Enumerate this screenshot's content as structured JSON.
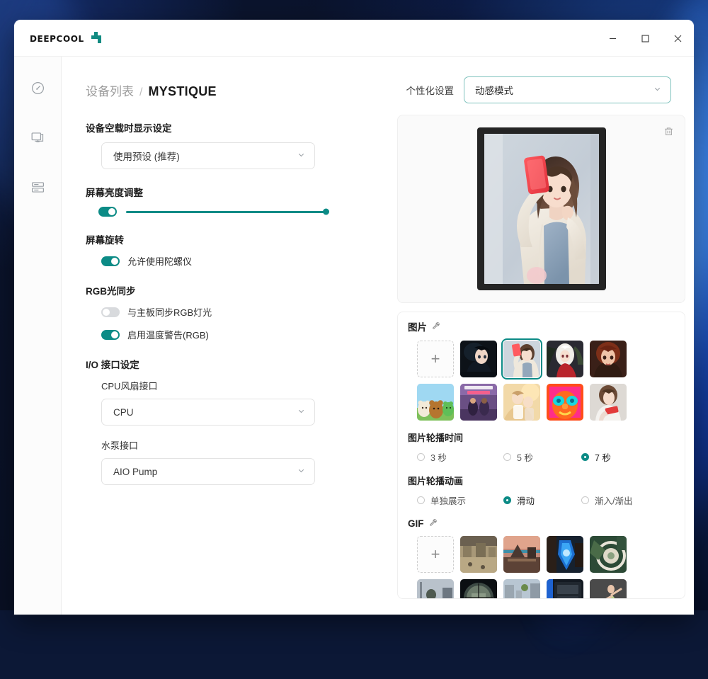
{
  "window": {
    "brand": "DeepCool",
    "controls": {
      "minimize": "–",
      "maximize": "□",
      "close": "✕"
    }
  },
  "sidebar": {
    "items": [
      {
        "name": "dashboard",
        "icon": "gauge-icon"
      },
      {
        "name": "display",
        "icon": "monitor-icon"
      },
      {
        "name": "devices",
        "icon": "server-list-icon"
      }
    ]
  },
  "header": {
    "breadcrumb_parent": "设备列表",
    "breadcrumb_sep": "/",
    "breadcrumb_current": "MYSTIQUE",
    "mode_label": "个性化设置",
    "mode_value": "动感模式"
  },
  "settings": {
    "idle_display": {
      "title": "设备空载时显示设定",
      "value": "使用预设 (推荐)"
    },
    "brightness": {
      "title": "屏幕亮度调整",
      "enabled": true,
      "value": 100
    },
    "rotation": {
      "title": "屏幕旋转",
      "gyro_label": "允许使用陀螺仪",
      "gyro_on": true
    },
    "rgb_sync": {
      "title": "RGB光同步",
      "mb_sync_label": "与主板同步RGB灯光",
      "mb_sync_on": false,
      "temp_warn_label": "启用温度警告(RGB)",
      "temp_warn_on": true
    },
    "io": {
      "title": "I/O 接口设定",
      "cpu_fan_label": "CPU风扇接口",
      "cpu_fan_value": "CPU",
      "pump_label": "水泵接口",
      "pump_value": "AIO Pump"
    }
  },
  "preview": {
    "delete_icon": "trash-icon",
    "device_name": "MYSTIQUE"
  },
  "images_section": {
    "title": "图片",
    "edit_icon": "wrench-icon",
    "add_label": "+",
    "thumbs": [
      {
        "id": "img-1",
        "selected": false,
        "desc": "anime-dark-hair-character"
      },
      {
        "id": "img-2",
        "selected": true,
        "desc": "girl-taking-selfie"
      },
      {
        "id": "img-3",
        "selected": false,
        "desc": "white-hair-anime-girl-red"
      },
      {
        "id": "img-4",
        "selected": false,
        "desc": "red-hair-game-character"
      },
      {
        "id": "img-5",
        "selected": false,
        "desc": "cartoon-bear-characters"
      },
      {
        "id": "img-6",
        "selected": false,
        "desc": "gta-style-poster"
      },
      {
        "id": "img-7",
        "selected": false,
        "desc": "anime-girls-sunset"
      },
      {
        "id": "img-8",
        "selected": false,
        "desc": "neon-thermal-face"
      },
      {
        "id": "img-9",
        "selected": false,
        "desc": "girl-with-red-phone"
      }
    ],
    "interval_title": "图片轮播时间",
    "interval_options": [
      {
        "label": "3 秒",
        "selected": false
      },
      {
        "label": "5 秒",
        "selected": false
      },
      {
        "label": "7 秒",
        "selected": true
      }
    ],
    "animation_title": "图片轮播动画",
    "animation_options": [
      {
        "label": "单独展示",
        "selected": false
      },
      {
        "label": "滑动",
        "selected": true
      },
      {
        "label": "渐入/渐出",
        "selected": false
      }
    ]
  },
  "gif_section": {
    "title": "GIF",
    "edit_icon": "wrench-icon",
    "add_label": "+",
    "thumbs": [
      {
        "id": "gif-1",
        "desc": "desert-battle-scene"
      },
      {
        "id": "gif-2",
        "desc": "mech-sunset-scene"
      },
      {
        "id": "gif-3",
        "desc": "blue-neon-machine"
      },
      {
        "id": "gif-4",
        "desc": "green-tech-ring"
      },
      {
        "id": "gif-5",
        "desc": "soldier-walking"
      },
      {
        "id": "gif-6",
        "desc": "sniper-scope-view"
      },
      {
        "id": "gif-7",
        "desc": "city-street-daytime"
      },
      {
        "id": "gif-8",
        "desc": "pc-case-interior"
      },
      {
        "id": "gif-9",
        "desc": "dancer-green-dress"
      }
    ]
  },
  "colors": {
    "accent": "#0c8b86",
    "accent_border": "#7fc2bd",
    "text_primary": "#1f1f1f",
    "text_muted": "#9b9b9b"
  }
}
